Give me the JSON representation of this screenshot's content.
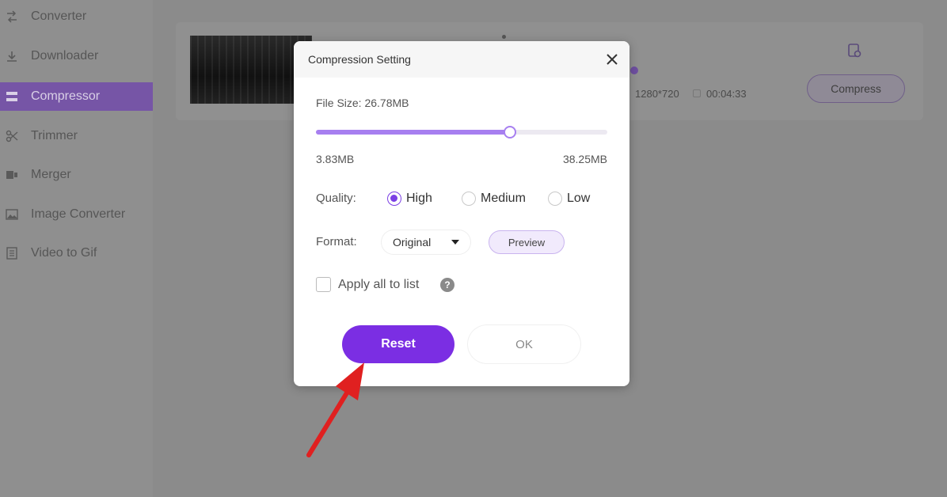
{
  "sidebar": {
    "items": [
      {
        "label": "Converter",
        "icon": "converter-icon",
        "active": false
      },
      {
        "label": "Downloader",
        "icon": "download-icon",
        "active": false
      },
      {
        "label": "Compressor",
        "icon": "compressor-icon",
        "active": true
      },
      {
        "label": "Trimmer",
        "icon": "scissors-icon",
        "active": false
      },
      {
        "label": "Merger",
        "icon": "merge-icon",
        "active": false
      },
      {
        "label": "Image Converter",
        "icon": "image-icon",
        "active": false
      },
      {
        "label": "Video to Gif",
        "icon": "gif-icon",
        "active": false
      }
    ]
  },
  "file": {
    "resolution": "1280*720",
    "duration": "00:04:33",
    "compress_label": "Compress"
  },
  "dialog": {
    "title": "Compression Setting",
    "file_size_label": "File Size: 26.78MB",
    "slider": {
      "min_label": "3.83MB",
      "max_label": "38.25MB",
      "min_mb": 3.83,
      "max_mb": 38.25,
      "value_mb": 26.78
    },
    "quality": {
      "label": "Quality:",
      "options": [
        {
          "label": "High",
          "checked": true
        },
        {
          "label": "Medium",
          "checked": false
        },
        {
          "label": "Low",
          "checked": false
        }
      ]
    },
    "format": {
      "label": "Format:",
      "value": "Original",
      "preview_label": "Preview"
    },
    "apply_all_label": "Apply all to list",
    "help_glyph": "?",
    "reset_label": "Reset",
    "ok_label": "OK"
  },
  "colors": {
    "accent": "#7b2ee3",
    "slider": "#a77ff0",
    "annotation_arrow": "#e02020"
  }
}
